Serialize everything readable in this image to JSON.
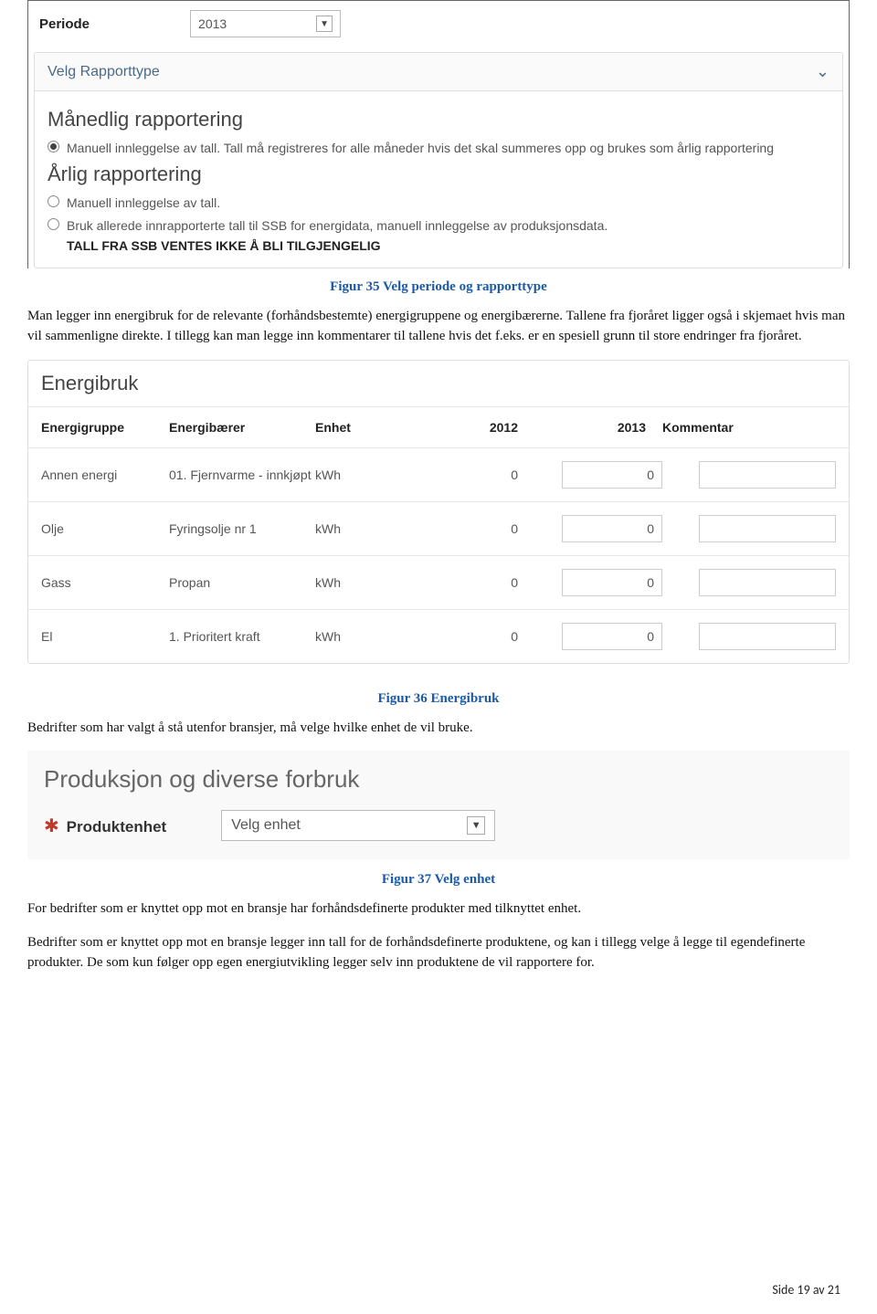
{
  "periode": {
    "label": "Periode",
    "value": "2013"
  },
  "reportPanel": {
    "header": "Velg Rapporttype",
    "monthly": {
      "title": "Månedlig rapportering",
      "opt1": "Manuell innleggelse av tall. Tall må registreres for alle måneder hvis det skal summeres opp og brukes som årlig rapportering"
    },
    "yearly": {
      "title": "Årlig rapportering",
      "opt1": "Manuell innleggelse av tall.",
      "opt2": "Bruk allerede innrapporterte tall til SSB for energidata, manuell innleggelse av produksjonsdata.",
      "note": "TALL FRA SSB VENTES IKKE Å BLI TILGJENGELIG"
    }
  },
  "caption35": "Figur 35 Velg periode og rapporttype",
  "para1": "Man legger inn energibruk for de relevante (forhåndsbestemte) energigruppene og energibærerne. Tallene fra fjoråret ligger også i skjemaet hvis man vil sammenligne direkte. I tillegg kan man legge inn kommentarer til tallene hvis det f.eks. er en spesiell grunn til store endringer fra fjoråret.",
  "energibruk": {
    "title": "Energibruk",
    "headers": {
      "c1": "Energigruppe",
      "c2": "Energibærer",
      "c3": "Enhet",
      "c4": "2012",
      "c5": "2013",
      "c6": "Kommentar"
    },
    "rows": [
      {
        "c1": "Annen energi",
        "c2": "01. Fjernvarme - innkjøpt",
        "c3": "kWh",
        "c4": "0",
        "c5": "0",
        "c6": ""
      },
      {
        "c1": "Olje",
        "c2": "Fyringsolje nr 1",
        "c3": "kWh",
        "c4": "0",
        "c5": "0",
        "c6": ""
      },
      {
        "c1": "Gass",
        "c2": "Propan",
        "c3": "kWh",
        "c4": "0",
        "c5": "0",
        "c6": ""
      },
      {
        "c1": "El",
        "c2": "1. Prioritert kraft",
        "c3": "kWh",
        "c4": "0",
        "c5": "0",
        "c6": ""
      }
    ]
  },
  "caption36": "Figur 36 Energibruk",
  "para2": "Bedrifter som har valgt å stå utenfor bransjer, må velge hvilke enhet de vil bruke.",
  "prod": {
    "title": "Produksjon og diverse forbruk",
    "label": "Produktenhet",
    "value": "Velg enhet"
  },
  "caption37": "Figur 37 Velg enhet",
  "para3": "For bedrifter som er knyttet opp mot en bransje har forhåndsdefinerte produkter med tilknyttet enhet.",
  "para4": "Bedrifter som er knyttet opp mot en bransje legger inn tall for de forhåndsdefinerte produktene, og kan i tillegg velge å legge til egendefinerte produkter. De som kun følger opp egen energiutvikling legger selv inn produktene de vil rapportere for.",
  "footer": "Side 19 av 21"
}
